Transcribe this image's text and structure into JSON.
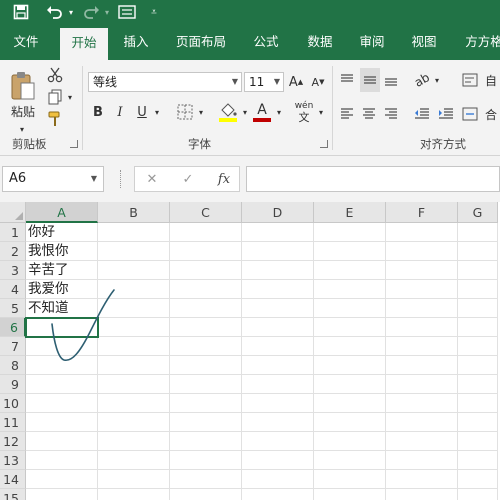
{
  "colors": {
    "accent": "#217346",
    "ribbon_bg": "#f3f3f3",
    "ink": "#2e5f72",
    "font_color_bar": "#c00000",
    "fill_color_bar": "#ffff00"
  },
  "quick_access": [
    {
      "icon": "save-icon"
    },
    {
      "icon": "undo-icon"
    },
    {
      "icon": "redo-icon"
    },
    {
      "icon": "form-icon"
    },
    {
      "icon": "customize-dropdown-icon"
    }
  ],
  "tabs": [
    "文件",
    "开始",
    "插入",
    "页面布局",
    "公式",
    "数据",
    "审阅",
    "视图",
    "方方格"
  ],
  "active_tab": "开始",
  "ribbon": {
    "clipboard": {
      "paste_label": "粘贴",
      "group_label": "剪贴板"
    },
    "font": {
      "font_name": "等线",
      "font_size": "11",
      "group_label": "字体"
    },
    "alignment": {
      "group_label": "对齐方式"
    }
  },
  "formula_bar": {
    "name_box": "A6",
    "fx_label": "fx",
    "cancel": "✕",
    "enter": "✓",
    "formula_value": ""
  },
  "grid": {
    "columns": [
      "A",
      "B",
      "C",
      "D",
      "E",
      "F",
      "G"
    ],
    "rows": [
      "1",
      "2",
      "3",
      "4",
      "5",
      "6",
      "7",
      "8",
      "9",
      "10",
      "11",
      "12",
      "13",
      "14",
      "15"
    ],
    "selected_column": "A",
    "selected_row": "6",
    "cells_A": [
      "你好",
      "我恨你",
      "辛苦了",
      "我爱你",
      "不知道",
      "",
      "",
      "",
      "",
      "",
      "",
      "",
      "",
      "",
      ""
    ]
  }
}
